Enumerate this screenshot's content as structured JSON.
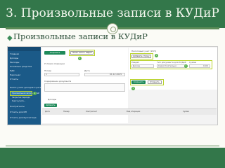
{
  "slide": {
    "title": "3. Произвольные записи в КУДиР",
    "bullet": "Произвольные записи в КУДиР"
  },
  "sidebar": {
    "items": [
      "Главная",
      "Доходы",
      "Расходы",
      "Основные средства",
      "НДС",
      "Персонал",
      "Отчеты",
      "Книга учета доходов и расходов",
      "Произвольная запись КУДиР",
      "Закрытие периода",
      "Книга учета...",
      "Контрагенты",
      "Отчеты для ИП",
      "Отчеты для бухгалтера"
    ],
    "badge": "1"
  },
  "middle": {
    "save_btn": "Сохранить",
    "new_entry_btn": "Новая запись КУДиР",
    "badge": "2",
    "section_label": "Условия операции",
    "date_label": "Дата",
    "number_label": "Номер",
    "number_value": "1",
    "date_value": "01.12.2015",
    "content_label": "Содержание документа",
    "income_label": "Доходы",
    "add_btn": "Добавить"
  },
  "right": {
    "header": "Налоговый учет (УСН)",
    "tab_label": "Добавить строку",
    "badge3": "3",
    "field1_label": "Раздел",
    "field1_value": "Доход",
    "field2_label": "Тип документа для КУДиР",
    "field2_value": "Самостоятельно",
    "field3_label": "Сумма",
    "field3_value": "0,00",
    "badge4": "4",
    "save_btn": "Сохранить",
    "cancel_btn": "Отменить",
    "badge5": "5"
  },
  "table": {
    "headers": [
      "Дата",
      "Номер",
      "Контрагент",
      "Вид операции",
      "Сумма"
    ]
  }
}
